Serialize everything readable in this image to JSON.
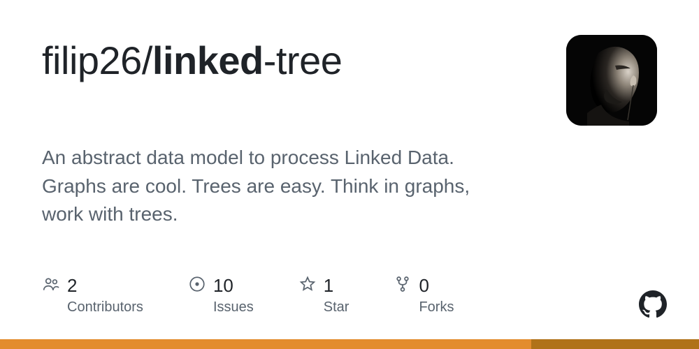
{
  "repo": {
    "owner": "filip26",
    "slash": "/",
    "name_bold": "linked",
    "name_rest": "-tree"
  },
  "description": "An abstract data model to process Linked Data. Graphs are cool. Trees are easy. Think in graphs, work with trees.",
  "stats": {
    "contributors": {
      "count": "2",
      "label": "Contributors"
    },
    "issues": {
      "count": "10",
      "label": "Issues"
    },
    "star": {
      "count": "1",
      "label": "Star"
    },
    "forks": {
      "count": "0",
      "label": "Forks"
    }
  },
  "colors": {
    "bar_primary": "#e38c2d",
    "bar_secondary": "#b07219"
  },
  "language_bar": {
    "primary_pct": 76,
    "secondary_pct": 24
  }
}
